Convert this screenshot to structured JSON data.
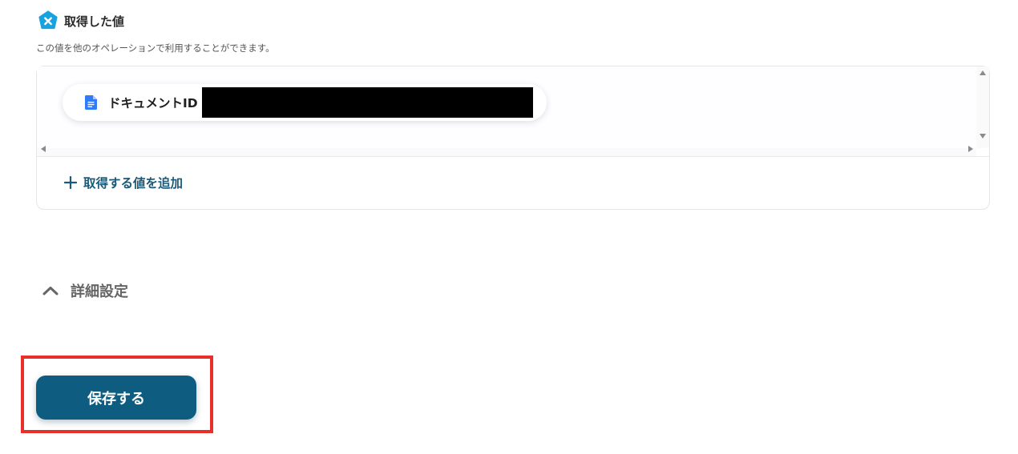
{
  "section": {
    "title": "取得した値",
    "description": "この値を他のオペレーションで利用することができます。",
    "icon": "x-badge-icon",
    "accent_color": "#16a3e0"
  },
  "values": {
    "items": [
      {
        "icon": "google-docs-icon",
        "label": "ドキュメントID",
        "value_redacted": true
      }
    ],
    "add_label": "取得する値を追加"
  },
  "advanced": {
    "label": "詳細設定",
    "expanded": true
  },
  "actions": {
    "save_label": "保存する",
    "save_color": "#0e5d80",
    "highlight_color": "#e8302a"
  }
}
